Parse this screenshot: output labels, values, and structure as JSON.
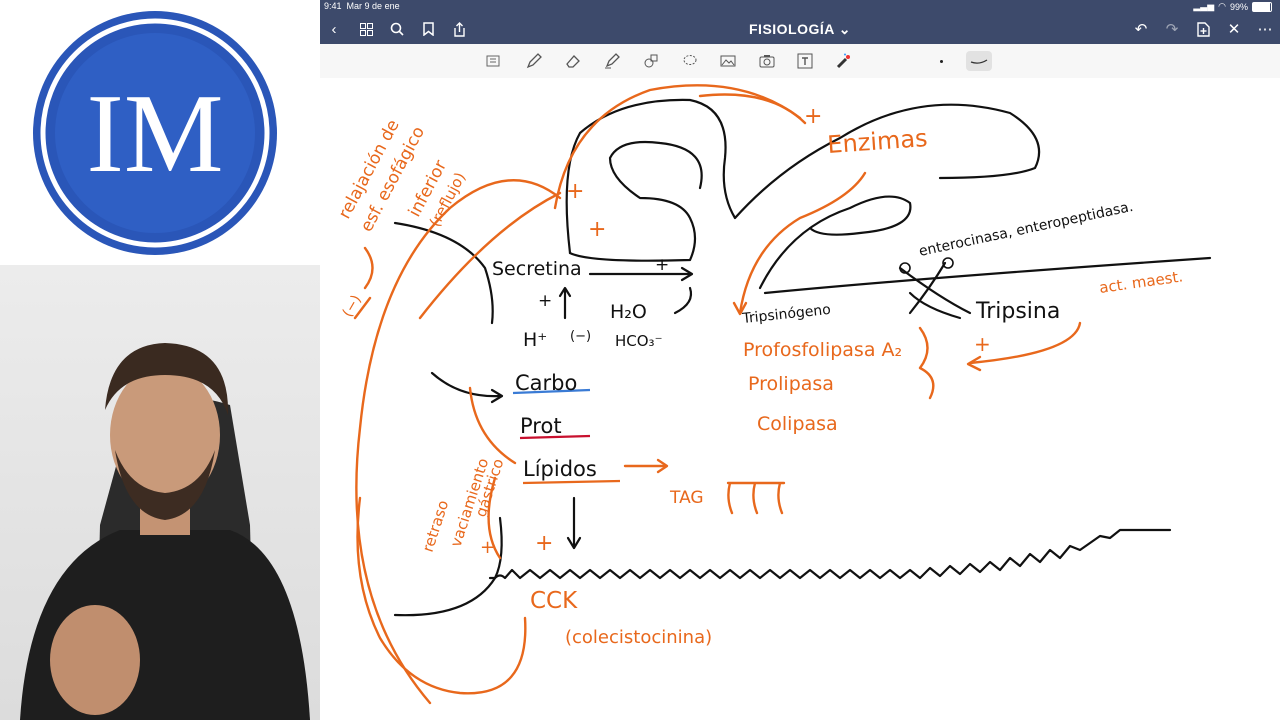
{
  "status": {
    "time": "9:41",
    "date": "Mar 9 de ene",
    "battery": "99%"
  },
  "header": {
    "title": "FISIOLOGÍA ⌄"
  },
  "logo": {
    "initials": "IM"
  },
  "notes": {
    "black": {
      "secretina": "Secretina",
      "h2o": "H₂O",
      "h_plus": "H⁺",
      "hco3": "HCO₃⁻",
      "minus": "(−)",
      "carbo": "Carbo",
      "prot": "Prot",
      "lipidos": "Lípidos",
      "enteroquinasa": "enterocinasa, enteropeptidasa.",
      "tripsinogeno": "Tripsinógeno",
      "tripsina": "Tripsina"
    },
    "orange": {
      "relajacion_1": "relajación de",
      "relajacion_2": "esf. esofágico",
      "relajacion_3": "inferior",
      "relajacion_4": "(reflujo)",
      "enzimas": "Enzimas",
      "plus_top": "+",
      "act_maest": "act. maest.",
      "profosfolipasa": "Profosfolipasa A₂",
      "prolipasa": "Prolipasa",
      "colipasa": "Colipasa",
      "tag": "TAG",
      "retraso_1": "retraso",
      "retraso_2": "vaciamiento",
      "retraso_3": "gástrico",
      "cck": "CCK",
      "colecistocinina": "(colecistocinina)",
      "plus": "+",
      "arrow_minus": "(−)"
    }
  }
}
